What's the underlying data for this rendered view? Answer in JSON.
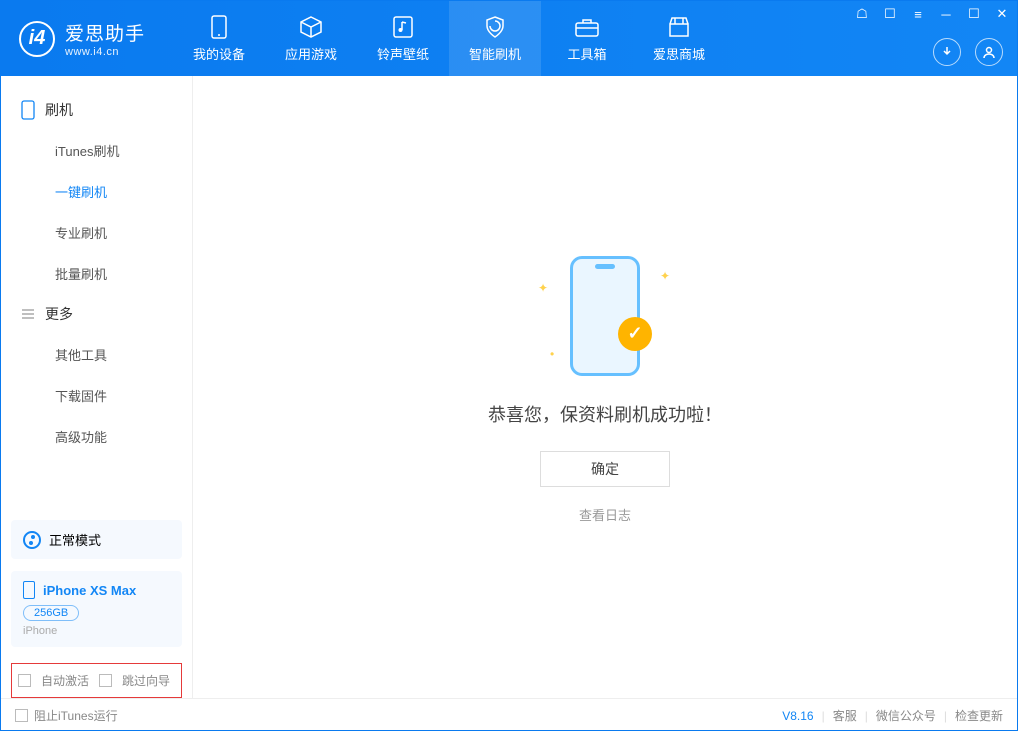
{
  "app": {
    "title": "爱思助手",
    "subtitle": "www.i4.cn"
  },
  "tabs": [
    {
      "label": "我的设备",
      "icon": "device"
    },
    {
      "label": "应用游戏",
      "icon": "cube"
    },
    {
      "label": "铃声壁纸",
      "icon": "music"
    },
    {
      "label": "智能刷机",
      "icon": "shield"
    },
    {
      "label": "工具箱",
      "icon": "toolbox"
    },
    {
      "label": "爱思商城",
      "icon": "store"
    }
  ],
  "sidebar": {
    "group1": "刷机",
    "items1": [
      "iTunes刷机",
      "一键刷机",
      "专业刷机",
      "批量刷机"
    ],
    "group2": "更多",
    "items2": [
      "其他工具",
      "下载固件",
      "高级功能"
    ]
  },
  "mode_card": {
    "label": "正常模式"
  },
  "device": {
    "name": "iPhone XS Max",
    "storage": "256GB",
    "type": "iPhone"
  },
  "options": {
    "auto_activate": "自动激活",
    "skip_guide": "跳过向导"
  },
  "main": {
    "success_msg": "恭喜您，保资料刷机成功啦！",
    "ok": "确定",
    "view_log": "查看日志"
  },
  "footer": {
    "block_itunes": "阻止iTunes运行",
    "version": "V8.16",
    "support": "客服",
    "wechat": "微信公众号",
    "update": "检查更新"
  }
}
